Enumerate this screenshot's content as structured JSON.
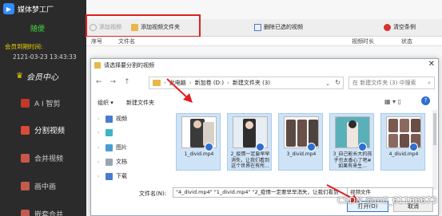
{
  "sidebar": {
    "app_name": "媒体梦工厂",
    "user_name": "随便",
    "expire_label": "会员到期时间:",
    "expire_value": "2121-03-23 13:43:33",
    "member_center": "会员中心",
    "nav": [
      {
        "label": "A I 智剪",
        "icon": "ai-icon"
      },
      {
        "label": "分割视频",
        "icon": "split-icon"
      },
      {
        "label": "合并视频",
        "icon": "merge-icon"
      },
      {
        "label": "画中画",
        "icon": "pip-icon"
      },
      {
        "label": "嵌套合并",
        "icon": "nest-icon"
      }
    ]
  },
  "toolbar": {
    "add_video": "添加视频",
    "add_folder": "添加视频文件夹",
    "delete_selected": "删除已选的视频",
    "clear_list": "清空条例"
  },
  "list_columns": {
    "index": "序号",
    "filename": "文件名",
    "path": "视频时长",
    "status": "状态"
  },
  "dialog": {
    "title": "请选择要分割的视频",
    "breadcrumb": [
      "此电脑",
      "新加卷 (D:)",
      "新建文件夹 (3)"
    ],
    "search_placeholder": "在 新建文件夹 (3) 中搜索",
    "organize": "组织 ▾",
    "new_folder": "新建文件夹",
    "tree": [
      {
        "label": "视频",
        "icon": "video-folder-icon",
        "color": "#4a7bd0"
      },
      {
        "label": "",
        "icon": "cube-icon",
        "color": "#3cb4c8"
      },
      {
        "label": "图片",
        "icon": "picture-folder-icon",
        "color": "#4a9cd0"
      },
      {
        "label": "文档",
        "icon": "document-folder-icon",
        "color": "#9aa4b0"
      },
      {
        "label": "下载",
        "icon": "download-folder-icon",
        "color": "#4a7bd0"
      }
    ],
    "files": [
      {
        "name": "1_divid.mp4"
      },
      {
        "name": "2_疫情一定要早早消失，让我们看到这个世界在有所..."
      },
      {
        "name": "3_divid.mp4"
      },
      {
        "name": "3_自己能长大的孩子也太香心了吧#如果有来生..."
      },
      {
        "name": "4_divid.mp4"
      }
    ],
    "filename_label": "文件名(N):",
    "filename_value": "\"4_divid.mp4\" \"1_divid.mp4\" \"2_疫情一定要早早消失，让我们看到",
    "filetype_value": "视频文件",
    "open_button": "打开(O)",
    "cancel_button": "取消"
  },
  "watermark": "CSDN @m0_61166673",
  "colors": {
    "sidebar_bg": "#2b2b2b",
    "highlight_red": "#e02020",
    "selection_blue": "#cfe3f7"
  }
}
